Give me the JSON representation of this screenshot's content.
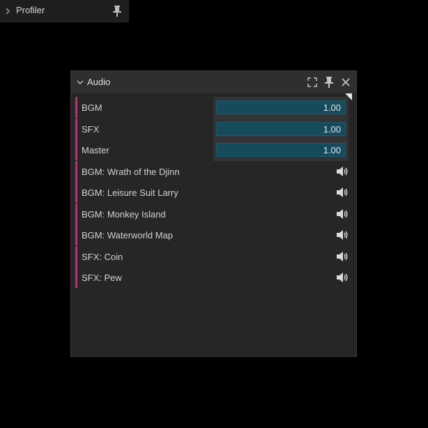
{
  "profiler_panel": {
    "title": "Profiler",
    "collapsed": true
  },
  "audio_panel": {
    "title": "Audio",
    "volumes": [
      {
        "label": "BGM",
        "value": "1.00"
      },
      {
        "label": "SFX",
        "value": "1.00"
      },
      {
        "label": "Master",
        "value": "1.00"
      }
    ],
    "sounds": [
      {
        "label": "BGM: Wrath of the Djinn"
      },
      {
        "label": "BGM: Leisure Suit Larry"
      },
      {
        "label": "BGM: Monkey Island"
      },
      {
        "label": "BGM: Waterworld Map"
      },
      {
        "label": "SFX: Coin"
      },
      {
        "label": "SFX: Pew"
      }
    ]
  },
  "icons": {
    "collapse": "chevron-right-icon",
    "expand": "chevron-down-icon",
    "pin": "pin-icon",
    "maximize": "maximize-icon",
    "close": "close-icon",
    "play": "speaker-icon"
  },
  "colors": {
    "background": "#000000",
    "panel": "#262627",
    "header": "#2f2f31",
    "accent": "#b8336f",
    "slider_fill": "#154b5d"
  }
}
